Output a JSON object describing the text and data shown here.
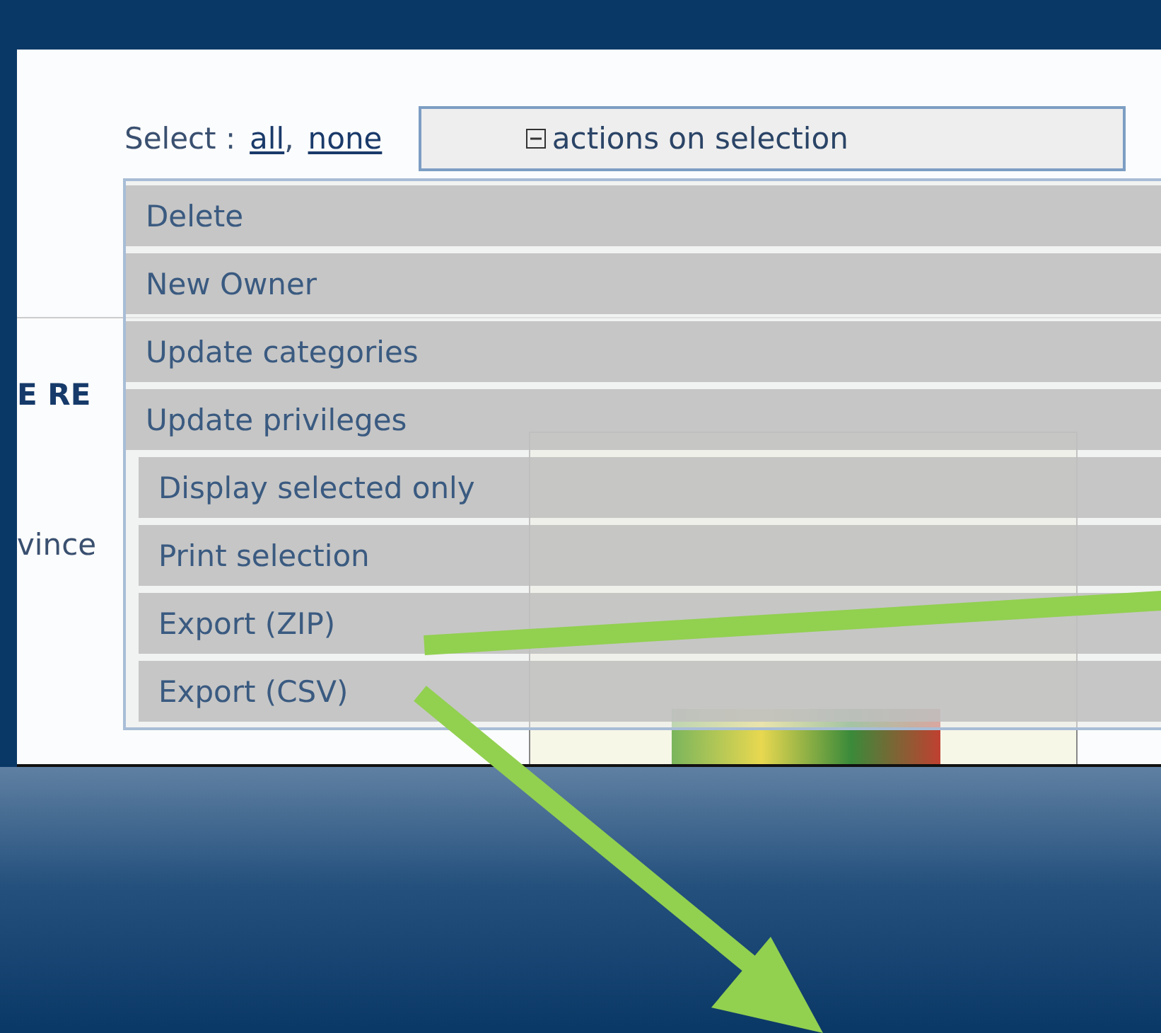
{
  "select": {
    "label": "Select :",
    "links": [
      "all",
      "none"
    ],
    "separator": ","
  },
  "actions_button": {
    "label": "actions on selection",
    "expanded": true
  },
  "background_texts": [
    "E RE",
    "vince"
  ],
  "menu": {
    "groups": [
      {
        "items": [
          "Delete",
          "New Owner",
          "Update categories",
          "Update privileges"
        ]
      },
      {
        "items": [
          "Display selected only",
          "Print selection",
          "Export (ZIP)",
          "Export (CSV)"
        ]
      }
    ]
  }
}
